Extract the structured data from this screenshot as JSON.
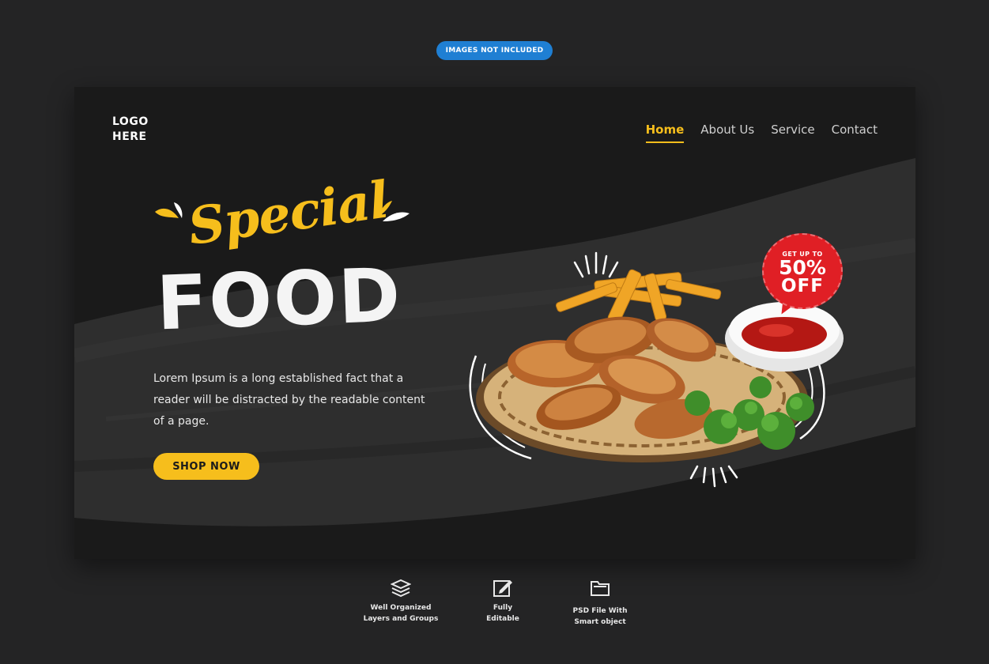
{
  "badge_top": "IMAGES NOT INCLUDED",
  "logo": {
    "line1": "LOGO",
    "line2": "HERE"
  },
  "nav": {
    "items": [
      "Home",
      "About Us",
      "Service",
      "Contact"
    ],
    "active": "Home"
  },
  "hero": {
    "title_script": "Special",
    "title_main": "FOOD",
    "description": "Lorem Ipsum is a long established fact that a reader will be distracted by the readable content of a page.",
    "cta_label": "SHOP NOW"
  },
  "discount": {
    "line1": "GET UP TO",
    "line2": "50%",
    "line3": "OFF"
  },
  "features": [
    {
      "icon": "layers-icon",
      "line1": "Well Organized",
      "line2": "Layers and Groups"
    },
    {
      "icon": "edit-icon",
      "line1": "Fully",
      "line2": "Editable"
    },
    {
      "icon": "folder-icon",
      "line1": "PSD File With",
      "line2": "Smart object"
    }
  ],
  "colors": {
    "background": "#242425",
    "card": "#1a1a1a",
    "accent_yellow": "#f6be1c",
    "badge_red": "#e01f25",
    "pill_blue": "#1f7fd3"
  }
}
